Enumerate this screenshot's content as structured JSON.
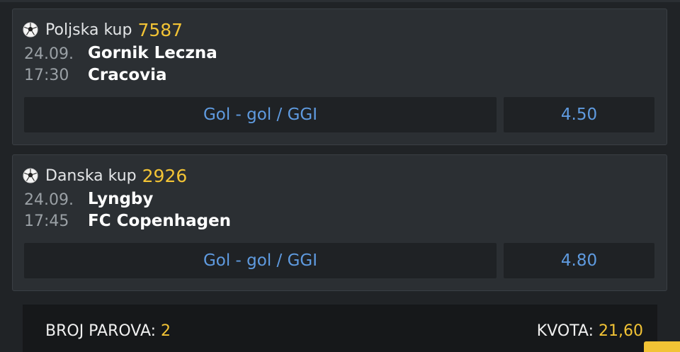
{
  "matches": [
    {
      "league": "Poljska kup",
      "code": "7587",
      "date": "24.09.",
      "time": "17:30",
      "home": "Gornik Leczna",
      "away": "Cracovia",
      "market": "Gol - gol / GGI",
      "odd": "4.50"
    },
    {
      "league": "Danska kup",
      "code": "2926",
      "date": "24.09.",
      "time": "17:45",
      "home": "Lyngby",
      "away": "FC Copenhagen",
      "market": "Gol - gol / GGI",
      "odd": "4.80"
    }
  ],
  "summary": {
    "pairs_label": "BROJ PAROVA:",
    "pairs_value": "2",
    "odds_label": "KVOTA:",
    "odds_value": "21,60"
  },
  "icons": {
    "sport": "soccer-ball-icon"
  },
  "colors": {
    "accent": "#f2c335",
    "link": "#5f9be0",
    "card": "#2b2f33",
    "background": "#202326"
  }
}
